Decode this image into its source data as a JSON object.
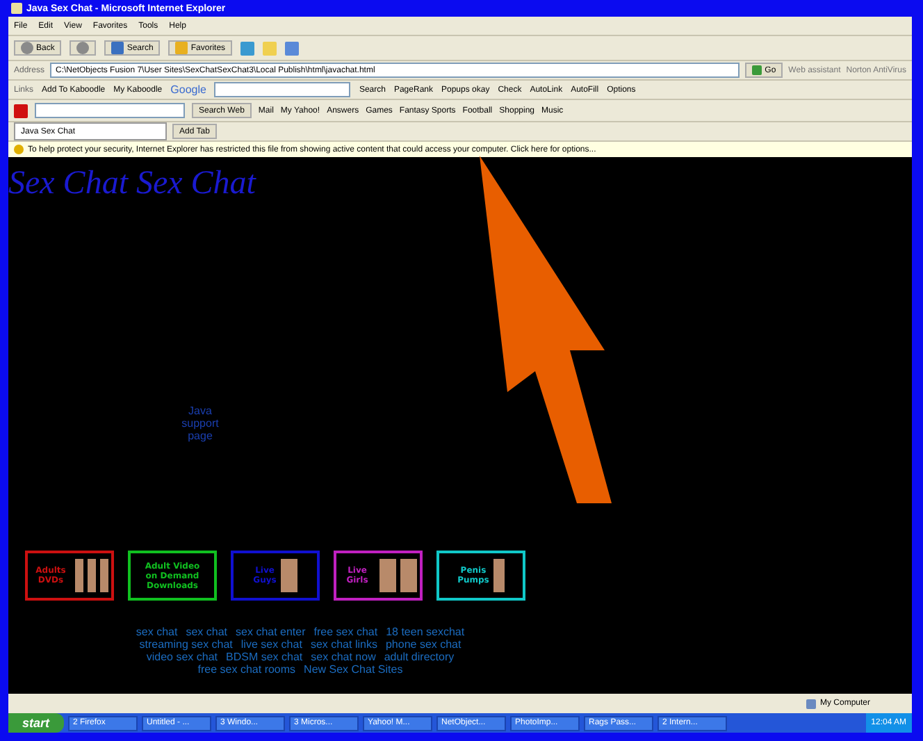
{
  "window": {
    "title": "Java Sex Chat - Microsoft Internet Explorer"
  },
  "menu": [
    "File",
    "Edit",
    "View",
    "Favorites",
    "Tools",
    "Help"
  ],
  "toolbar": [
    {
      "kind": "nav",
      "label": "Back"
    },
    {
      "kind": "nav"
    },
    {
      "kind": "text",
      "label": "Search"
    },
    {
      "kind": "text",
      "label": "Favorites"
    }
  ],
  "address": {
    "label": "Address",
    "value": "C:\\NetObjects Fusion 7\\User Sites\\SexChatSexChat3\\Local Publish\\html\\javachat.html",
    "go": "Go",
    "extras": [
      "Web assistant",
      "Norton AntiVirus"
    ]
  },
  "links_bar": {
    "label": "Links",
    "items": [
      "Add To Kaboodle",
      "My Kaboodle"
    ],
    "google": "Google",
    "google_items": [
      "Search",
      "PageRank",
      "Popups okay",
      "Check",
      "AutoLink",
      "AutoFill",
      "Options"
    ]
  },
  "yahoo_bar": {
    "search": "Search Web",
    "items": [
      "Mail",
      "My Yahoo!",
      "Answers",
      "Games",
      "Fantasy Sports",
      "Football",
      "Shopping",
      "Music"
    ]
  },
  "tabs": [
    {
      "label": "Java Sex Chat",
      "selected": true
    }
  ],
  "add_tab": "Add Tab",
  "infobar": "To help protect your security, Internet Explorer has restricted this file from showing active content that could access your computer. Click here for options...",
  "page": {
    "heading": "Sex Chat Sex Chat",
    "java_text": "Java support page",
    "banners": [
      {
        "kind": "covers",
        "lines": [
          "Adults DVDs"
        ],
        "color": "#cc1010"
      },
      {
        "kind": "text",
        "lines": [
          "Adult Video",
          "on Demand",
          "Downloads"
        ],
        "color": "#10c020"
      },
      {
        "kind": "photo",
        "lines": [
          "Live",
          "Guys"
        ],
        "color": "#1010d0"
      },
      {
        "kind": "pair",
        "lines": [
          "Live Girls"
        ],
        "color": "#c020c0"
      },
      {
        "kind": "product",
        "lines": [
          "Penis",
          "Pumps"
        ],
        "color": "#10c8c8"
      }
    ],
    "link_lines": [
      [
        "sex chat",
        "sex chat",
        "sex chat enter",
        "free sex chat",
        "18 teen sexchat"
      ],
      [
        "streaming sex chat",
        "live sex chat",
        "sex chat  links",
        "phone sex chat"
      ],
      [
        "video sex chat",
        "BDSM sex chat",
        "sex chat now",
        "adult directory"
      ],
      [
        "free sex chat rooms",
        "New Sex Chat Sites"
      ]
    ]
  },
  "status_bar": {
    "zone": "My Computer"
  },
  "taskbar": {
    "start": "start",
    "items": [
      "2 Firefox",
      "Untitled - ...",
      "3 Windo...",
      "3 Micros...",
      "Yahoo! M...",
      "NetObject...",
      "PhotoImp...",
      "Rags Pass...",
      "2 Intern..."
    ],
    "clock": "12:04 AM"
  }
}
